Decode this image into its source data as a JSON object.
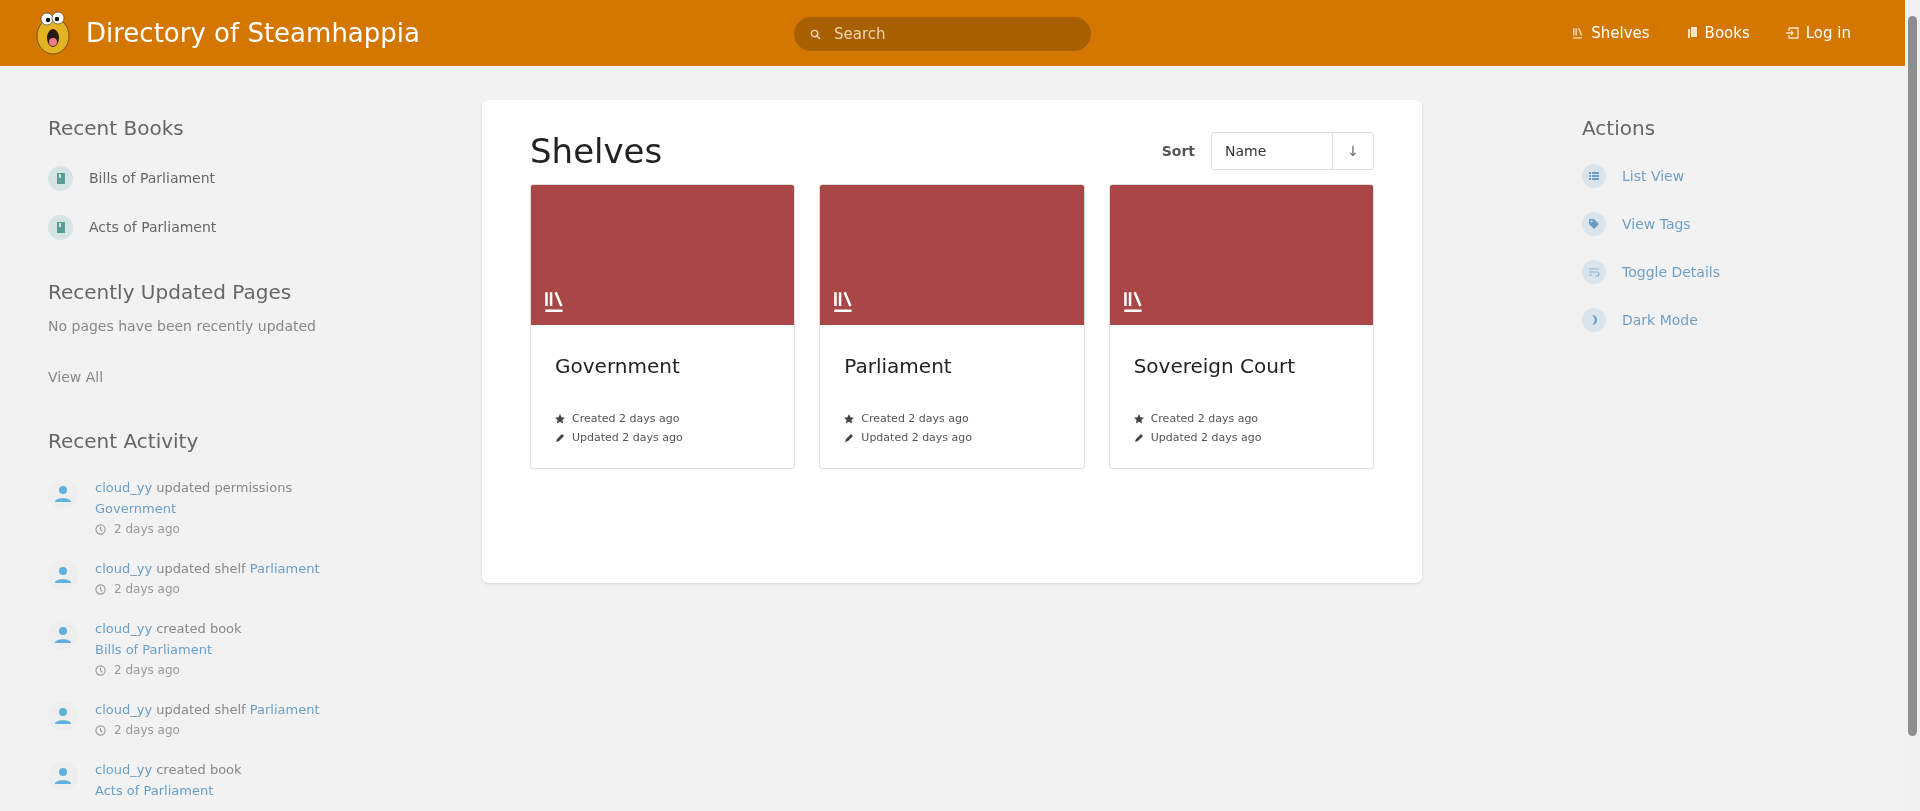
{
  "header": {
    "title": "Directory of Steamhappia",
    "search": {
      "placeholder": "Search"
    },
    "nav": [
      {
        "kind": "shelves",
        "label": "Shelves"
      },
      {
        "kind": "books",
        "label": "Books"
      },
      {
        "kind": "login",
        "label": "Log in"
      }
    ]
  },
  "recent_books": {
    "title": "Recent Books",
    "items": [
      "Bills of Parliament",
      "Acts of Parliament"
    ]
  },
  "recently_updated_pages": {
    "title": "Recently Updated Pages",
    "empty_message": "No pages have been recently updated",
    "view_all": "View All"
  },
  "recent_activity": {
    "title": "Recent Activity",
    "items": [
      {
        "user": "cloud_yy",
        "action": "updated permissions",
        "target": "Government",
        "time": "2 days ago"
      },
      {
        "user": "cloud_yy",
        "action": "updated shelf",
        "target": "Parliament",
        "time": "2 days ago"
      },
      {
        "user": "cloud_yy",
        "action": "created book",
        "target": "Bills of Parliament",
        "time": "2 days ago"
      },
      {
        "user": "cloud_yy",
        "action": "updated shelf",
        "target": "Parliament",
        "time": "2 days ago"
      },
      {
        "user": "cloud_yy",
        "action": "created book",
        "target": "Acts of Parliament"
      }
    ]
  },
  "main": {
    "title": "Shelves",
    "sort": {
      "label": "Sort",
      "value": "Name",
      "direction": "↓"
    },
    "shelves": [
      {
        "name": "Government",
        "created": "Created 2 days ago",
        "updated": "Updated 2 days ago"
      },
      {
        "name": "Parliament",
        "created": "Created 2 days ago",
        "updated": "Updated 2 days ago"
      },
      {
        "name": "Sovereign Court",
        "created": "Created 2 days ago",
        "updated": "Updated 2 days ago"
      }
    ]
  },
  "actions": {
    "title": "Actions",
    "items": [
      {
        "kind": "list",
        "label": "List View"
      },
      {
        "kind": "tag",
        "label": "View Tags"
      },
      {
        "kind": "details",
        "label": "Toggle Details"
      },
      {
        "kind": "dark",
        "label": "Dark Mode"
      }
    ]
  }
}
